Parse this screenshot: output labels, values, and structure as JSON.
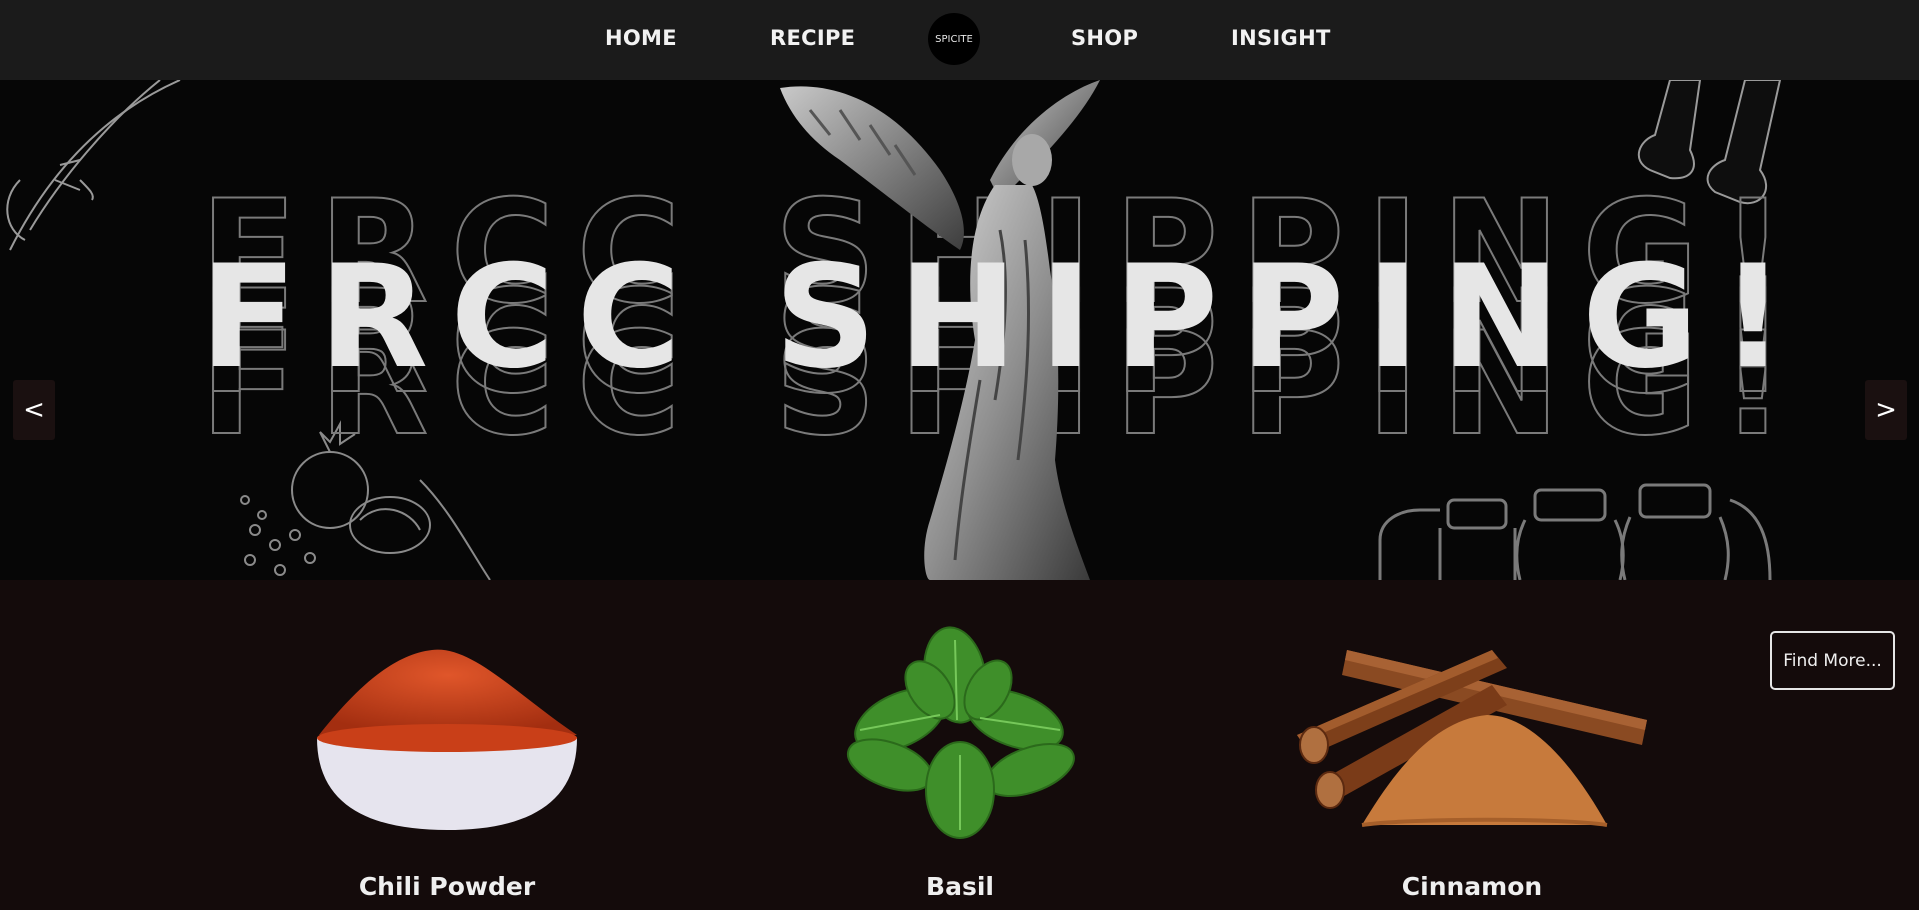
{
  "nav": {
    "home": "HOME",
    "recipe": "RECIPE",
    "logo": "SPICITE",
    "shop": "SHOP",
    "insight": "INSIGHT"
  },
  "hero": {
    "headline": "FRCC SHIPPING!",
    "prev": "<",
    "next": ">"
  },
  "products": [
    {
      "name": "Chili Powder"
    },
    {
      "name": "Basil"
    },
    {
      "name": "Cinnamon"
    }
  ],
  "find_more": "Find More...",
  "colors": {
    "nav_bg": "#1b1b1b",
    "hero_bg": "#060606",
    "section_bg": "#140b0b",
    "text": "#efefef"
  }
}
